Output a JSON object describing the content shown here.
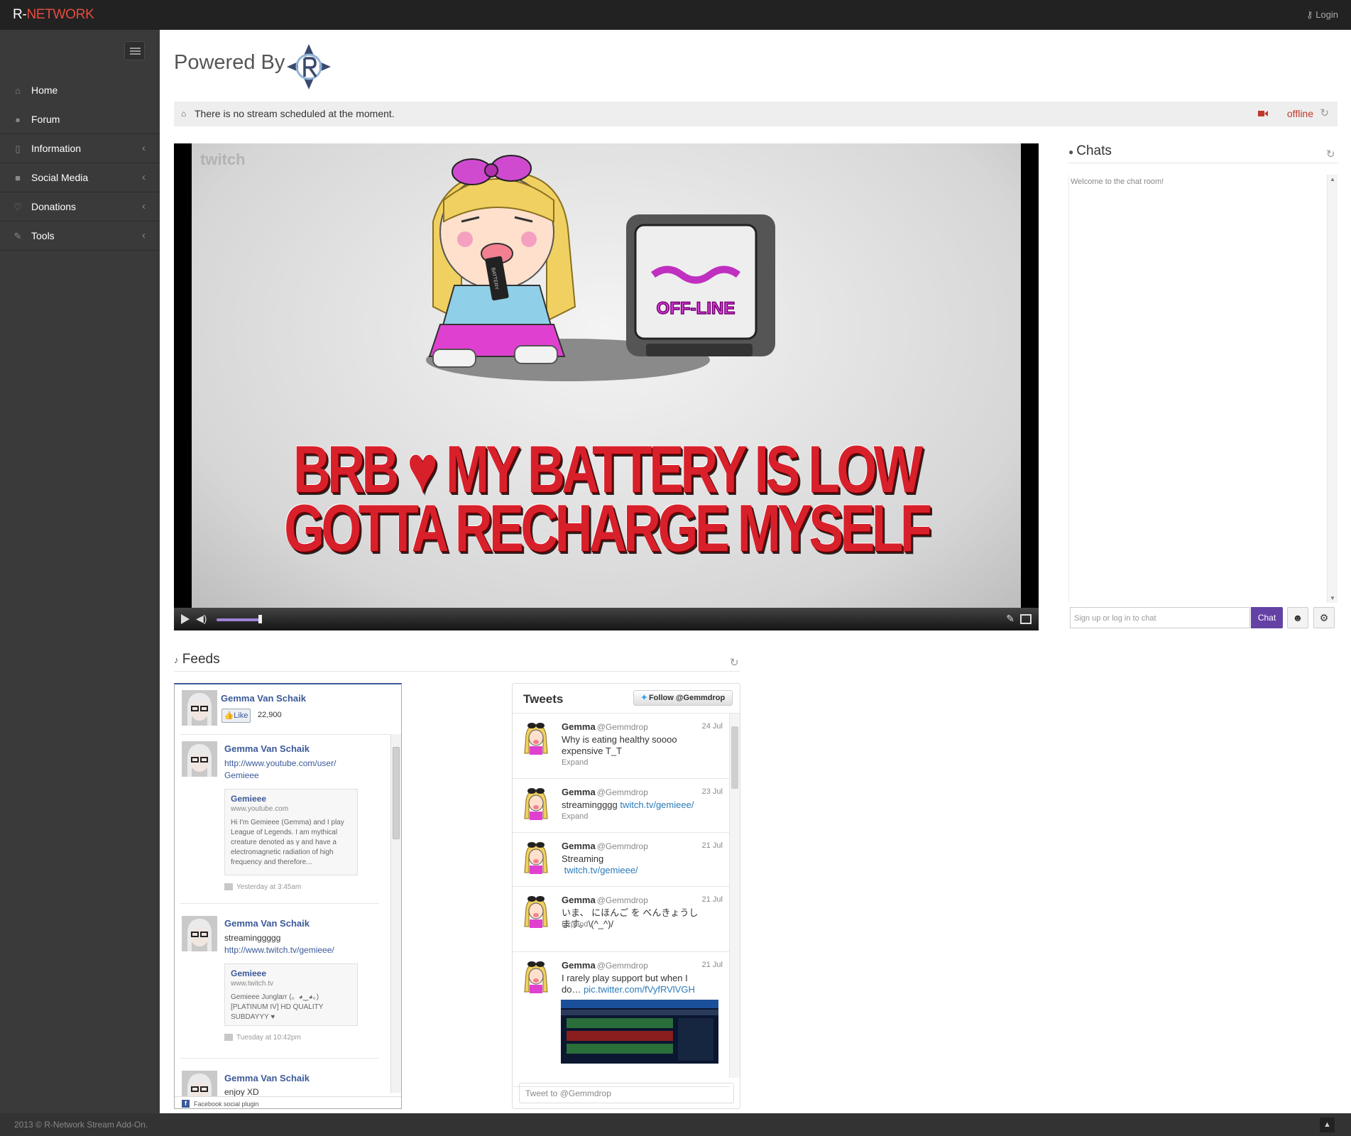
{
  "topbar": {
    "brand_prefix": "R-",
    "brand_suffix": "NETWORK",
    "login_label": "Login",
    "brand_color": "#e74c3c"
  },
  "sidebar": {
    "items": [
      {
        "label": "Home",
        "icon": "home-icon",
        "submenu": false
      },
      {
        "label": "Forum",
        "icon": "comments-icon",
        "submenu": false
      },
      {
        "label": "Information",
        "icon": "bookmark-icon",
        "submenu": true
      },
      {
        "label": "Social Media",
        "icon": "square-icon",
        "submenu": true
      },
      {
        "label": "Donations",
        "icon": "heart-icon",
        "submenu": true
      },
      {
        "label": "Tools",
        "icon": "wrench-icon",
        "submenu": true
      }
    ]
  },
  "header": {
    "powered_by": "Powered By"
  },
  "alert": {
    "message": "There is no stream scheduled at the moment.",
    "status": "offline",
    "status_color": "#c0392b"
  },
  "player": {
    "watermark": "twitch",
    "headline_line1": "BRB ♥ MY BATTERY IS LOW",
    "headline_line2": "GOTTA RECHARGE MYSELF",
    "tv_text": "OFF-LINE",
    "battery_text": "BATTERY",
    "volume_level": 0.8,
    "accent": "#9f83d6"
  },
  "chats": {
    "title": "Chats",
    "welcome": "Welcome to the chat room!",
    "input_placeholder": "Sign up or log in to chat",
    "chat_button": "Chat",
    "button_color": "#6441a5"
  },
  "feeds": {
    "title": "Feeds"
  },
  "facebook": {
    "page_name": "Gemma Van Schaik",
    "like_label": "Like",
    "like_count": "22,900",
    "posts": [
      {
        "author": "Gemma Van Schaik",
        "text": "",
        "link_line1": "http://www.youtube.com/user/",
        "link_line2": "Gemieee",
        "card_title": "Gemieee",
        "card_url": "www.youtube.com",
        "card_desc": "Hi I'm Gemieee (Gemma) and I play League of Legends. I am mythical creature denoted as γ and have a electromagnetic radiation of high frequency and therefore...",
        "time": "Yesterday at 3:45am"
      },
      {
        "author": "Gemma Van Schaik",
        "text": "streaminggggg",
        "link_line1": "http://www.twitch.tv/gemieee/",
        "link_line2": "",
        "card_title": "Gemieee",
        "card_url": "www.twitch.tv",
        "card_desc": "Gemieee Junglarr (。◕‿◕。) [PLATINUM IV] HD QUALITY SUBDAYYY ♥",
        "time": "Tuesday at 10:42pm"
      },
      {
        "author": "Gemma Van Schaik",
        "text": "enjoy XD"
      }
    ],
    "footer": "Facebook social plugin",
    "brand_color": "#3b5998"
  },
  "twitter": {
    "title": "Tweets",
    "follow_label": "Follow @Gemmdrop",
    "input_placeholder": "Tweet to @Gemmdrop",
    "tweets": [
      {
        "name": "Gemma",
        "handle": "@Gemmdrop",
        "date": "24 Jul",
        "text": "Why is eating healthy soooo expensive T_T",
        "link": "",
        "expand": "Expand"
      },
      {
        "name": "Gemma",
        "handle": "@Gemmdrop",
        "date": "23 Jul",
        "text": "streamingggg ",
        "link": "twitch.tv/gemieee/",
        "expand": "Expand"
      },
      {
        "name": "Gemma",
        "handle": "@Gemmdrop",
        "date": "21 Jul",
        "text": "Streaming\n ",
        "link": "twitch.tv/gemieee/",
        "expand": ""
      },
      {
        "name": "Gemma",
        "handle": "@Gemmdrop",
        "date": "21 Jul",
        "text": "いま、 にほんご を べんきょうします。\\(^_^)/",
        "link": "",
        "expand": "Expand"
      },
      {
        "name": "Gemma",
        "handle": "@Gemmdrop",
        "date": "21 Jul",
        "text": "I rarely play support but when I do… ",
        "link": "pic.twitter.com/fVyfRVlVGH",
        "expand": ""
      }
    ]
  },
  "footer": {
    "copyright": "2013 © R-Network Stream Add-On."
  }
}
